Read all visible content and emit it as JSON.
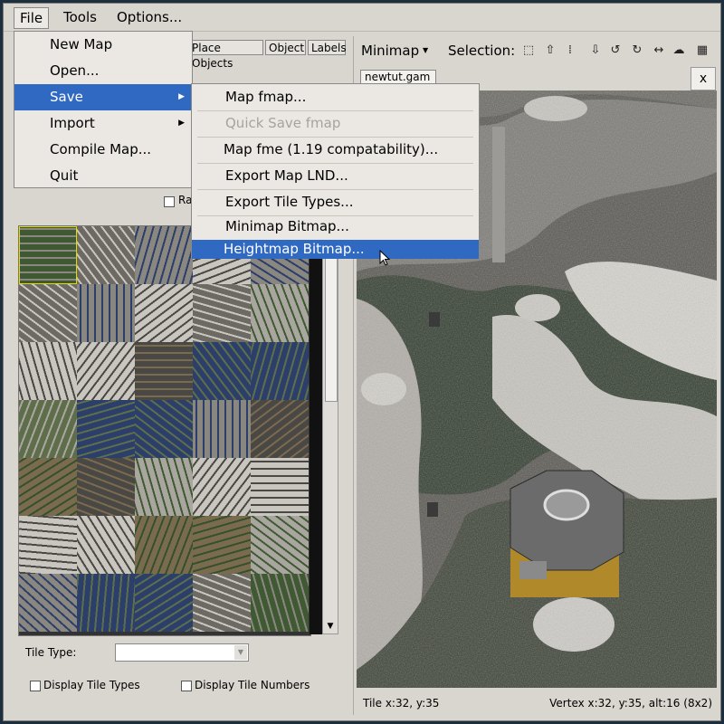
{
  "menubar": {
    "file": "File",
    "tools": "Tools",
    "options": "Options..."
  },
  "file_menu": [
    "New Map",
    "Open...",
    "Save",
    "Import",
    "Compile Map...",
    "Quit"
  ],
  "save_menu": [
    {
      "label": "Map fmap...",
      "disabled": false
    },
    {
      "label": "Quick Save fmap",
      "disabled": true
    },
    {
      "label": "Map fme (1.19 compatability)...",
      "disabled": false
    },
    {
      "label": "Export Map LND...",
      "disabled": false
    },
    {
      "label": "Export Tile Types...",
      "disabled": false
    },
    {
      "label": "Minimap Bitmap...",
      "disabled": false
    },
    {
      "label": "Heightmap Bitmap...",
      "disabled": false
    }
  ],
  "left": {
    "tabs": [
      "Place Objects",
      "Object",
      "Labels"
    ],
    "partial_check_label": "Ra",
    "tile_type_label": "Tile Type:",
    "tile_type_value": "",
    "display_tile_types": "Display Tile Types",
    "display_tile_numbers": "Display Tile Numbers"
  },
  "right": {
    "minimap_label": "Minimap",
    "selection_label": "Selection:",
    "file_tab": "newtut.gam",
    "close": "x",
    "status_tile": "Tile x:32, y:35",
    "status_vertex": "Vertex  x:32, y:35, alt:16 (8x2)"
  },
  "colors": {
    "accent": "#2f69c2",
    "background": "#1c2f3c",
    "window": "#d9d5cf"
  }
}
